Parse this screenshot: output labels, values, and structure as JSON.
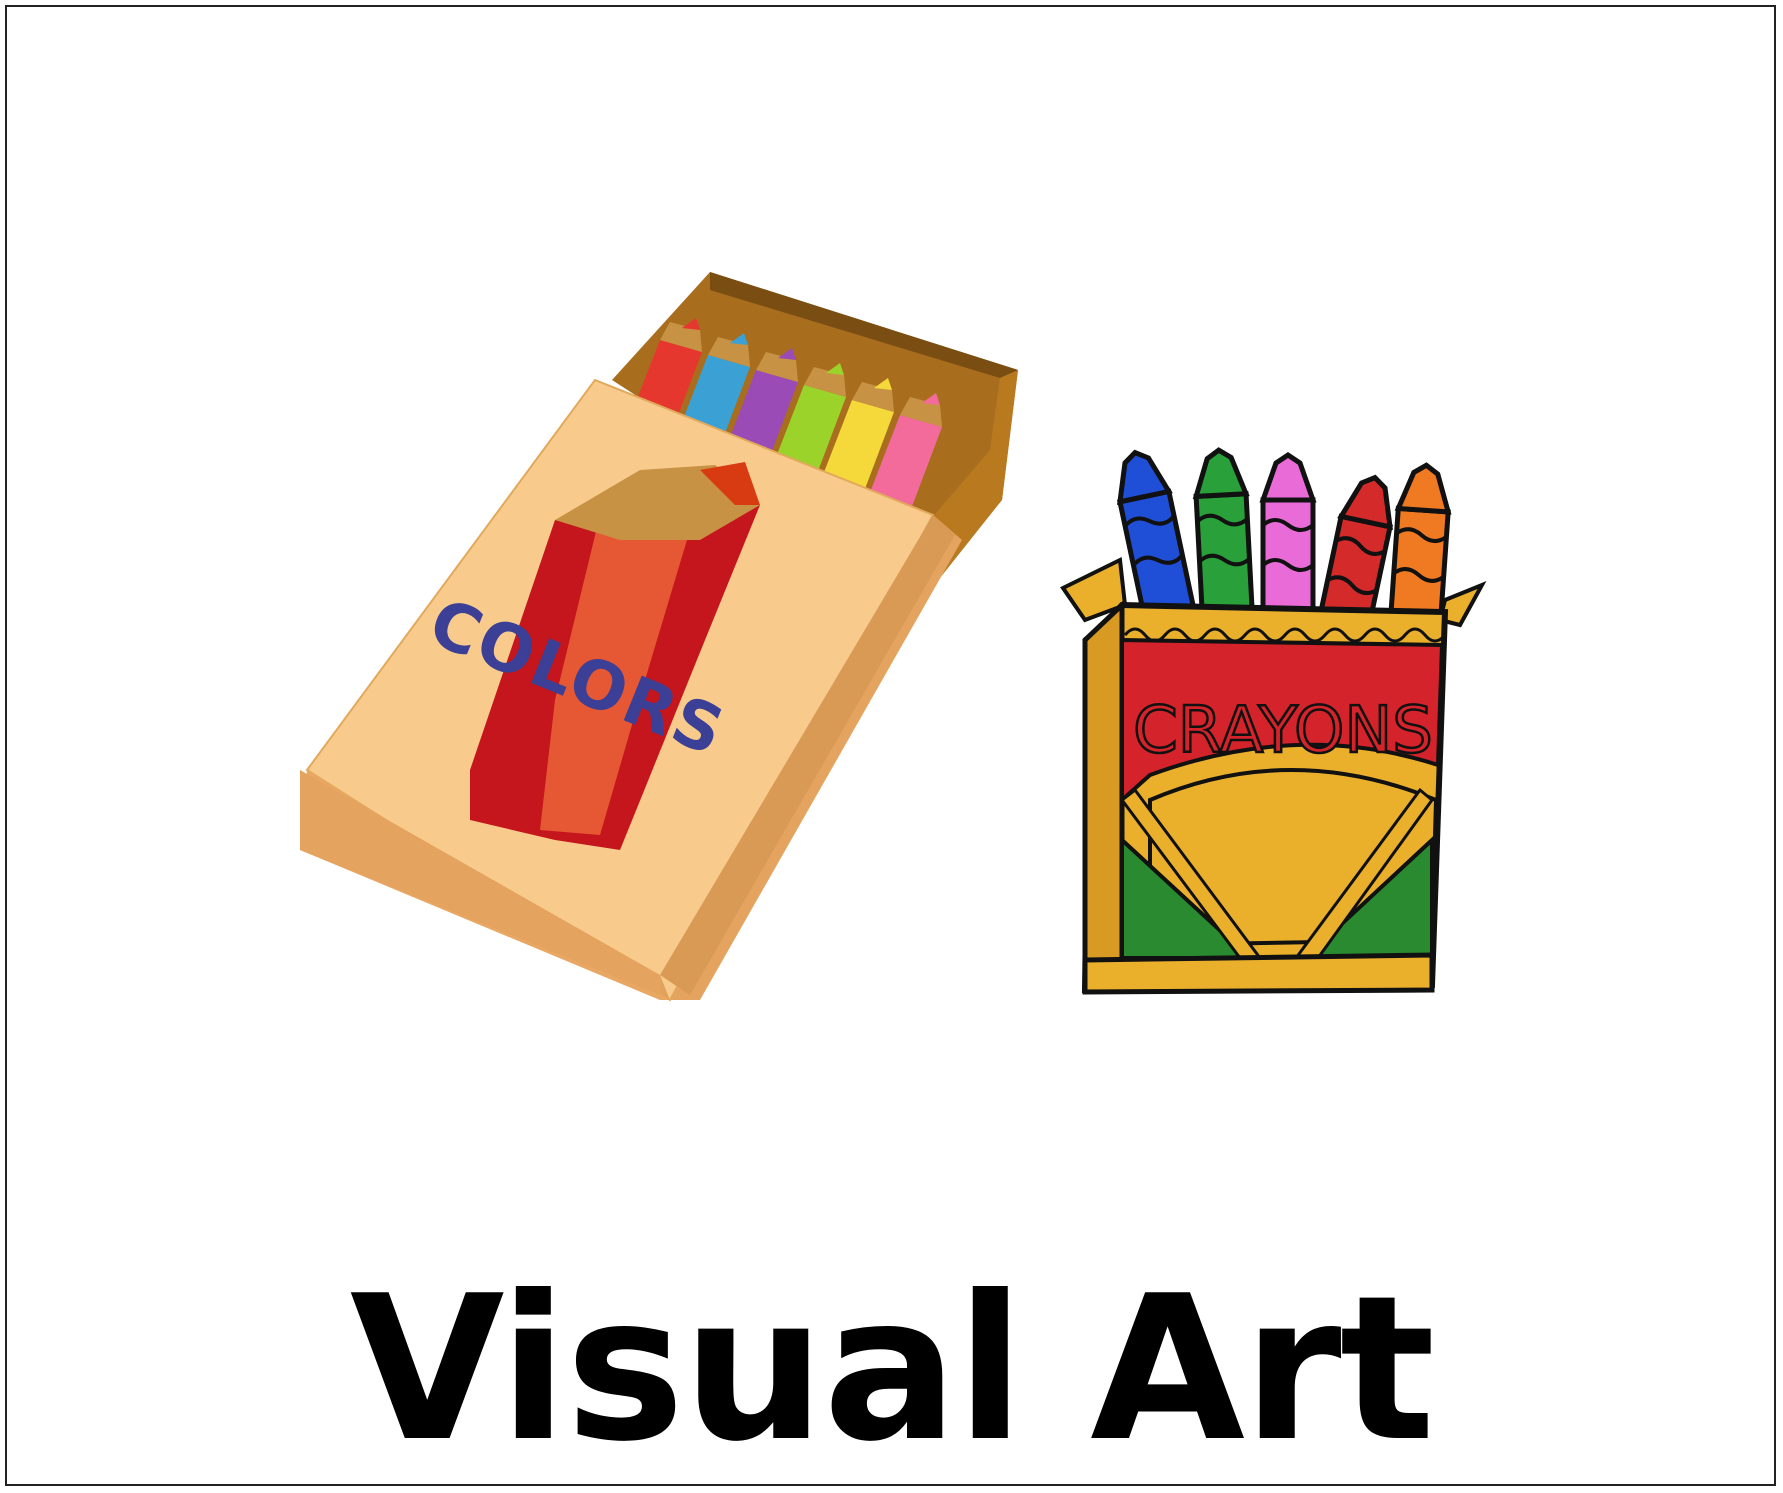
{
  "card": {
    "caption": "Visual Art"
  },
  "pencil_box": {
    "label": "COLORS",
    "label_color": "#3b3f95",
    "box_color": "#f7c98a",
    "pencil_colors": [
      "#e5372e",
      "#3ba0d4",
      "#9a4bb5",
      "#9bd32a",
      "#f5d83a",
      "#f36b9a"
    ]
  },
  "crayon_box": {
    "label": "CRAYONS",
    "label_color": "#1a1a1a",
    "band_color": "#d4232a",
    "box_color": "#eab02c",
    "crayon_colors": [
      "#1f4fd6",
      "#2aa03b",
      "#e86bd8",
      "#d42a2a",
      "#f07a22"
    ]
  }
}
